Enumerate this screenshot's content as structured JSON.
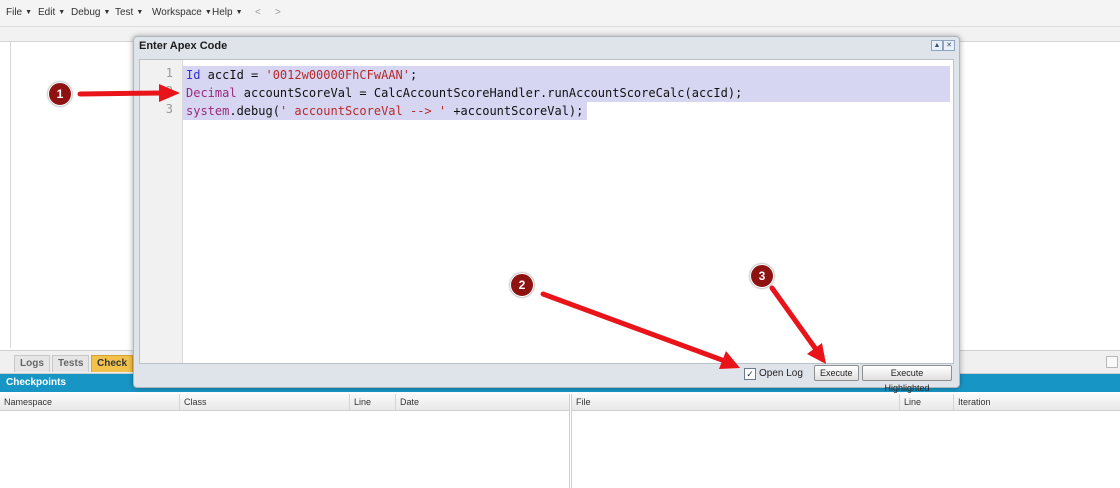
{
  "menu": {
    "items": [
      "File",
      "Edit",
      "Debug",
      "Test",
      "Workspace",
      "Help"
    ],
    "back": "<",
    "forward": ">"
  },
  "dialog": {
    "title": "Enter Apex Code",
    "code": {
      "line_numbers": [
        "1",
        "2",
        "3"
      ],
      "line1": {
        "kw": "Id",
        "rest": " accId = ",
        "str": "'0012w00000FhCFwAAN'",
        "end": ";"
      },
      "line2": {
        "kw": "Decimal",
        "rest": " accountScoreVal = CalcAccountScoreHandler.runAccountScoreCalc(accId);"
      },
      "line3": {
        "kw": "system",
        "rest": ".debug(",
        "str": "' accountScoreVal --> '",
        "end": " +accountScoreVal);"
      }
    },
    "open_log_label": "Open Log",
    "open_log_checked": true,
    "execute_label": "Execute",
    "execute_highlighted_label": "Execute Highlighted"
  },
  "bottom_tabs": {
    "logs": "Logs",
    "tests": "Tests",
    "checkpoints": "Check"
  },
  "checkpoints": {
    "header": "Checkpoints",
    "left_columns": [
      "Namespace",
      "Class",
      "Line",
      "Date"
    ],
    "right_columns": [
      "File",
      "Line",
      "Iteration"
    ]
  },
  "annotations": {
    "badge1": "1",
    "badge2": "2",
    "badge3": "3",
    "arrow_color": "#e8141a",
    "badge_color": "#8e1212"
  }
}
